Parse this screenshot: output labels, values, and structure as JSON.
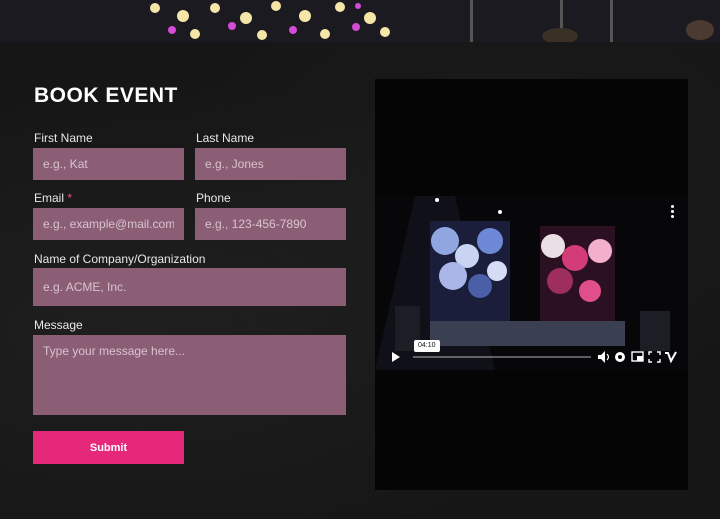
{
  "form": {
    "title": "BOOK EVENT",
    "first_name": {
      "label": "First Name",
      "placeholder": "e.g., Kat"
    },
    "last_name": {
      "label": "Last Name",
      "placeholder": "e.g., Jones"
    },
    "email": {
      "label": "Email",
      "required_mark": "*",
      "placeholder": "e.g., example@mail.com"
    },
    "phone": {
      "label": "Phone",
      "placeholder": "e.g., 123-456-7890"
    },
    "company": {
      "label": "Name of Company/Organization",
      "placeholder": "e.g. ACME, Inc."
    },
    "message": {
      "label": "Message",
      "placeholder": "Type your message here..."
    },
    "submit_label": "Submit"
  },
  "video": {
    "hover_time": "04:10",
    "progress_fraction": 0.0
  },
  "colors": {
    "accent": "#e5287a",
    "field_bg": "#8c5e76",
    "background": "#161616",
    "required": "#e94b8a"
  },
  "icons": [
    "play-icon",
    "volume-icon",
    "settings-icon",
    "pip-icon",
    "fullscreen-icon",
    "vimeo-logo-icon",
    "more-options-icon"
  ]
}
